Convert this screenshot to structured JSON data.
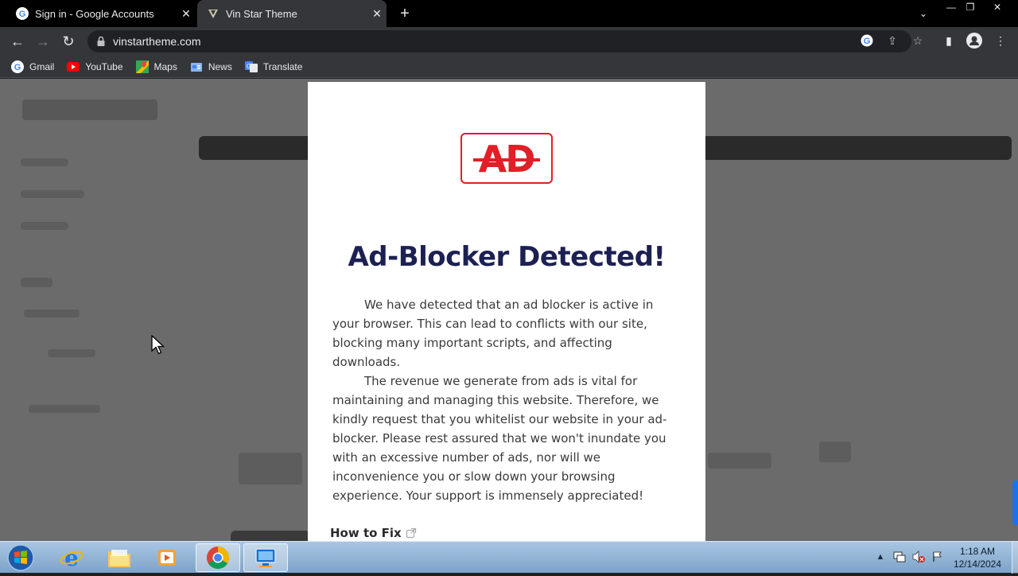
{
  "browser": {
    "tabs": [
      {
        "title": "Sign in - Google Accounts",
        "icon": "google-g-icon"
      },
      {
        "title": "Vin Star Theme",
        "icon": "vin-star-favicon",
        "active": true
      }
    ],
    "url": "vinstartheme.com",
    "bookmarks": [
      {
        "label": "Gmail",
        "icon": "google-g-icon"
      },
      {
        "label": "YouTube",
        "icon": "youtube-icon"
      },
      {
        "label": "Maps",
        "icon": "maps-icon"
      },
      {
        "label": "News",
        "icon": "news-icon"
      },
      {
        "label": "Translate",
        "icon": "translate-icon"
      }
    ]
  },
  "modal": {
    "logo_text": "AD",
    "title": "Ad-Blocker Detected!",
    "paragraph1": "We have detected that an ad blocker is active in your browser. This can lead to conflicts with our site, blocking many important scripts, and affecting downloads.",
    "paragraph2": "The revenue we generate from ads is vital for maintaining and managing this website. Therefore, we kindly request that you whitelist our website in your ad-blocker. Please rest assured that we won't inundate you with an excessive number of ads, nor will we inconvenience you or slow down your browsing experience. Your support is immensely appreciated!",
    "link": "How to Fix"
  },
  "taskbar": {
    "time": "1:18 AM",
    "date": "12/14/2024"
  },
  "colors": {
    "brand_red": "#e21e26",
    "heading_navy": "#1d2052",
    "overlay_gray": "#6b6b6b"
  }
}
